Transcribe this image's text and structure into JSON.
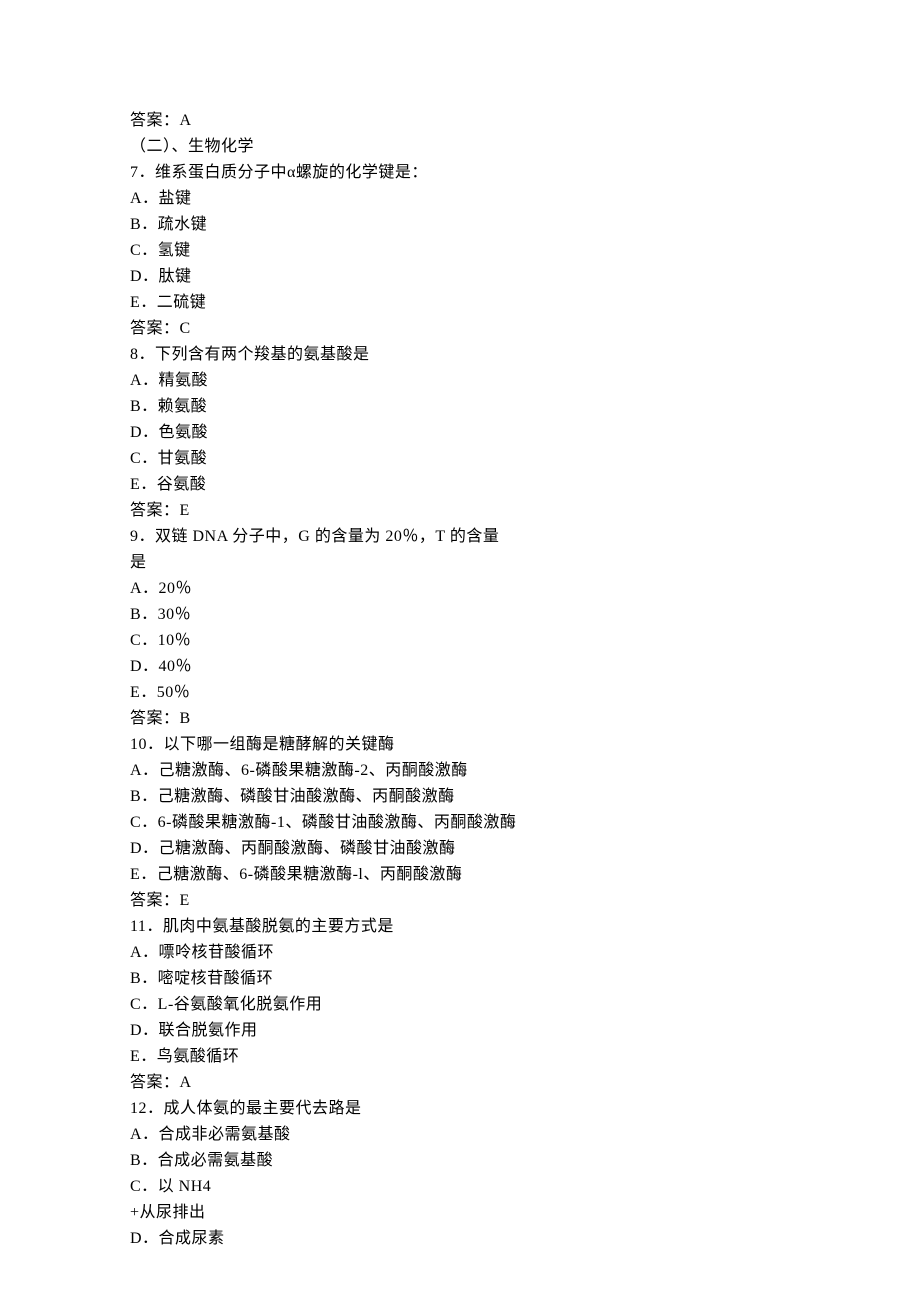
{
  "lines": [
    "答案：A",
    "（二）、生物化学",
    "7．维系蛋白质分子中α螺旋的化学键是：",
    "A．盐键",
    "B．疏水键",
    "C．氢键",
    "D．肽键",
    "E．二硫键",
    "答案：C",
    "8．下列含有两个羧基的氨基酸是",
    "A．精氨酸",
    "B．赖氨酸",
    "D．色氨酸",
    "C．甘氨酸",
    "E．谷氨酸",
    "答案：E",
    "9．双链 DNA 分子中，G 的含量为 20％，T 的含量",
    "是",
    "A．20％",
    "B．30％",
    "C．10％",
    "D．40％",
    "E．50％",
    "答案：B",
    "10．以下哪一组酶是糖酵解的关键酶",
    "A．己糖激酶、6-磷酸果糖激酶-2、丙酮酸激酶",
    "B．己糖激酶、磷酸甘油酸激酶、丙酮酸激酶",
    "C．6-磷酸果糖激酶-1、磷酸甘油酸激酶、丙酮酸激酶",
    "D．己糖激酶、丙酮酸激酶、磷酸甘油酸激酶",
    "E．己糖激酶、6-磷酸果糖激酶-l、丙酮酸激酶",
    "答案：E",
    "11．肌肉中氨基酸脱氨的主要方式是",
    "A．嘌呤核苷酸循环",
    "B．嘧啶核苷酸循环",
    "C．L-谷氨酸氧化脱氨作用",
    "D．联合脱氨作用",
    "E．鸟氨酸循环",
    "答案：A",
    "12．成人体氨的最主要代去路是",
    "A．合成非必需氨基酸",
    "B．合成必需氨基酸",
    "C．以 NH4",
    "+从尿排出",
    "D．合成尿素"
  ]
}
